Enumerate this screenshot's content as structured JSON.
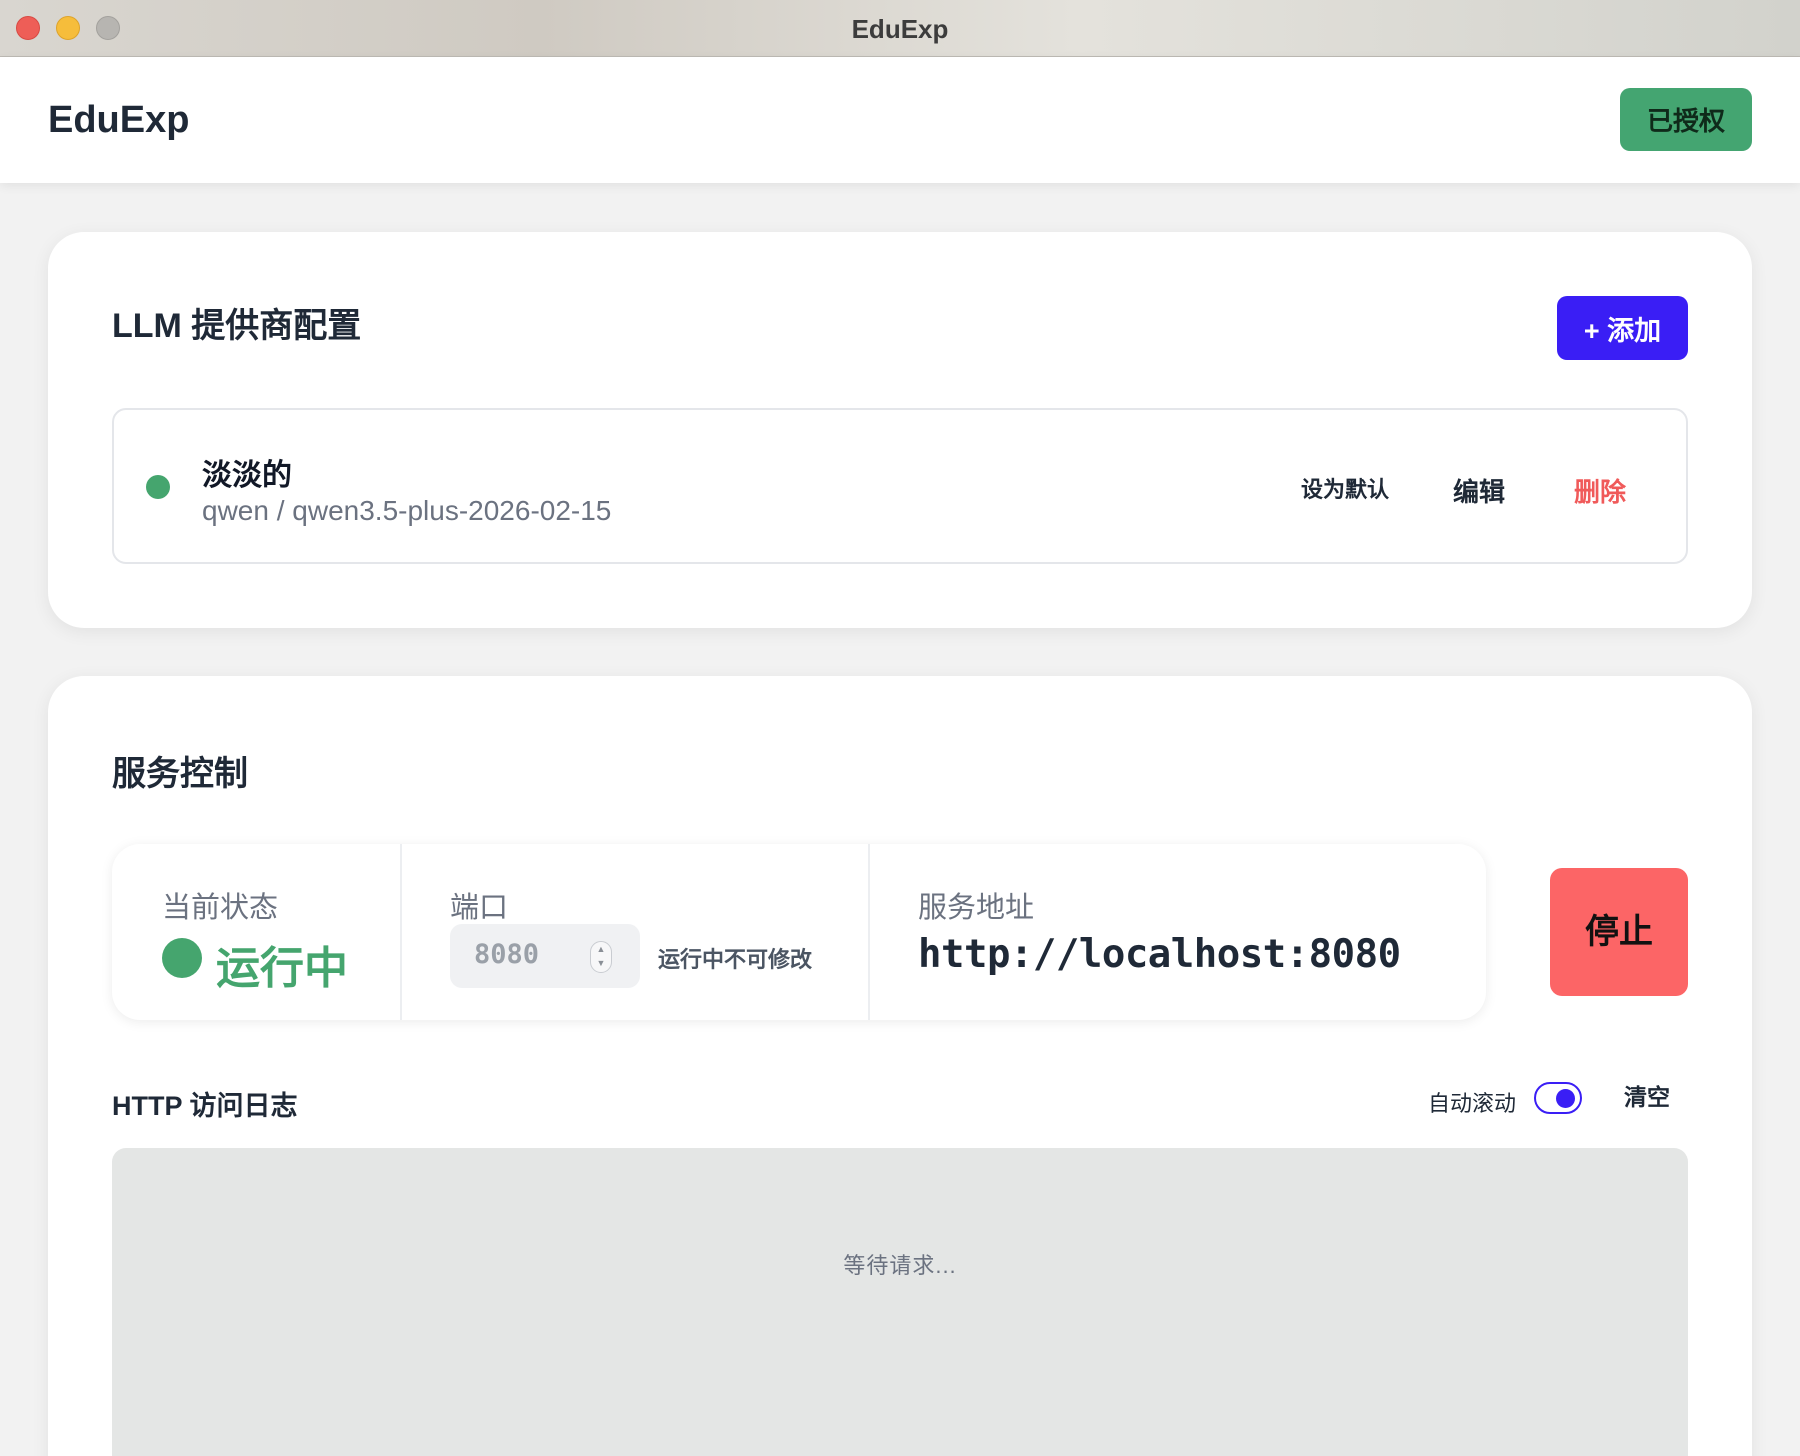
{
  "window": {
    "title": "EduExp"
  },
  "header": {
    "app_name": "EduExp",
    "auth_label": "已授权"
  },
  "llm": {
    "title": "LLM 提供商配置",
    "add_label": "+ 添加",
    "providers": [
      {
        "name": "淡淡的",
        "model": "qwen / qwen3.5-plus-2026-02-15",
        "status_color": "#45a56e",
        "actions": {
          "set_default": "设为默认",
          "edit": "编辑",
          "delete": "删除"
        }
      }
    ]
  },
  "service": {
    "title": "服务控制",
    "status_label": "当前状态",
    "status_value": "运行中",
    "status_color": "#45a56e",
    "port_label": "端口",
    "port_value": "8080",
    "port_note": "运行中不可修改",
    "address_label": "服务地址",
    "address_value": "http://localhost:8080",
    "stop_label": "停止",
    "stop_color": "#fc6566"
  },
  "log": {
    "title": "HTTP 访问日志",
    "autoscroll_label": "自动滚动",
    "autoscroll_on": true,
    "clear_label": "清空",
    "empty_text": "等待请求..."
  },
  "colors": {
    "accent": "#3a1ef5",
    "success": "#44a571",
    "danger": "#f05a5a"
  }
}
